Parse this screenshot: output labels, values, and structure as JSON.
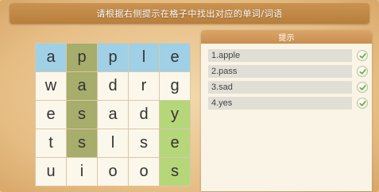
{
  "instruction": "请根据右侧提示在格子中找出对应的单词/词语",
  "grid": {
    "rows": [
      [
        {
          "letter": "a",
          "color": "#9fd0e6"
        },
        {
          "letter": "p",
          "color": "#a7ad6a"
        },
        {
          "letter": "p",
          "color": "#9fd0e6"
        },
        {
          "letter": "l",
          "color": "#9fd0e6"
        },
        {
          "letter": "e",
          "color": "#9fd0e6"
        }
      ],
      [
        {
          "letter": "w",
          "color": "#fbf7ea"
        },
        {
          "letter": "a",
          "color": "#a7ad6a"
        },
        {
          "letter": "d",
          "color": "#fbf7ea"
        },
        {
          "letter": "r",
          "color": "#fbf7ea"
        },
        {
          "letter": "g",
          "color": "#fbf7ea"
        }
      ],
      [
        {
          "letter": "e",
          "color": "#fbf7ea"
        },
        {
          "letter": "s",
          "color": "#a7ad6a"
        },
        {
          "letter": "a",
          "color": "#fbf7ea"
        },
        {
          "letter": "d",
          "color": "#fbf7ea"
        },
        {
          "letter": "y",
          "color": "#b6d67a"
        }
      ],
      [
        {
          "letter": "t",
          "color": "#fbf7ea"
        },
        {
          "letter": "s",
          "color": "#a7ad6a"
        },
        {
          "letter": "l",
          "color": "#fbf7ea"
        },
        {
          "letter": "s",
          "color": "#fbf7ea"
        },
        {
          "letter": "e",
          "color": "#b6d67a"
        }
      ],
      [
        {
          "letter": "u",
          "color": "#fbf7ea"
        },
        {
          "letter": "i",
          "color": "#fbf7ea"
        },
        {
          "letter": "o",
          "color": "#fbf7ea"
        },
        {
          "letter": "o",
          "color": "#fbf7ea"
        },
        {
          "letter": "s",
          "color": "#b6d67a"
        }
      ]
    ]
  },
  "hints": {
    "title": "提示",
    "items": [
      {
        "label": "1.apple",
        "icon": "check-icon"
      },
      {
        "label": "2.pass",
        "icon": "check-icon"
      },
      {
        "label": "3.sad",
        "icon": "check-icon"
      },
      {
        "label": "4.yes",
        "icon": "check-icon"
      }
    ]
  },
  "colors": {
    "check": "#6aa431"
  }
}
